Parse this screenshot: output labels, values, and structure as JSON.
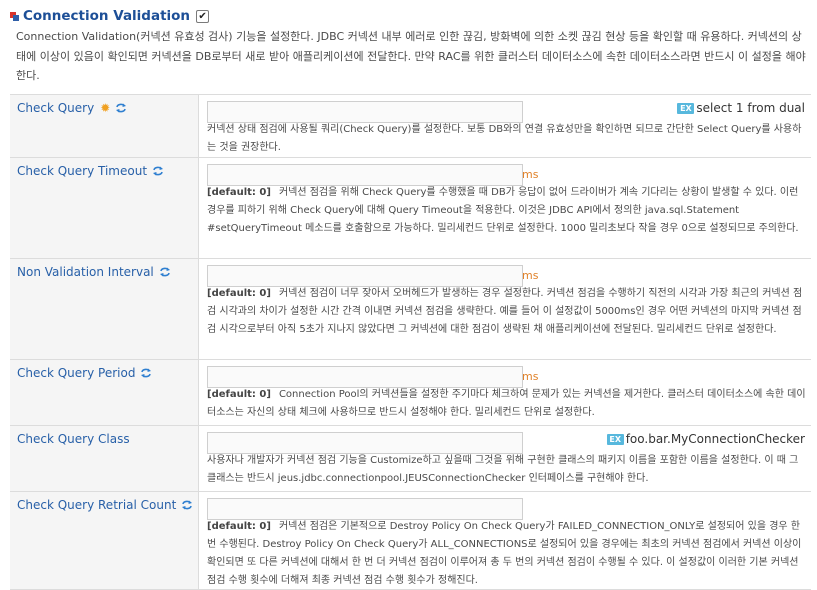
{
  "section": {
    "title": "Connection Validation",
    "enabled": true,
    "description": "Connection Validation(커넥션 유효성 검사) 기능을 설정한다. JDBC 커넥션 내부 에러로 인한 끊김, 방화벽에 의한 소켓 끊김 현상 등을 확인할 때 유용하다. 커넥션의 상태에 이상이 있음이 확인되면 커넥션을 DB로부터 새로 받아 애플리케이션에 전달한다. 만약 RAC를 위한 클러스터 데이터소스에 속한 데이터소스라면 반드시 이 설정을 해야한다."
  },
  "colors": {
    "label": "#2860a8",
    "unit": "#e0822a",
    "gear": "#f0a020",
    "example_badge": "#57b8dd"
  },
  "ex_badge": "EX",
  "fields": [
    {
      "label": "Check Query",
      "required": true,
      "value": "",
      "example": "select 1 from dual",
      "description": "커넥션 상태 점검에 사용될 쿼리(Check Query)를 설정한다. 보통 DB와의 연결 유효성만을 확인하면 되므로 간단한 Select Query를 사용하는 것을 권장한다."
    },
    {
      "label": "Check Query Timeout",
      "value": "",
      "unit": "ms",
      "default": "[default: 0]",
      "description": "커넥션 점검을 위해 Check Query를 수행했을 때 DB가 응답이 없어 드라이버가 계속 기다리는 상황이 발생할 수 있다. 이런 경우를 피하기 위해 Check Query에 대해 Query Timeout을 적용한다. 이것은 JDBC API에서 정의한 java.sql.Statement #setQueryTimeout 메소드를 호출함으로 가능하다. 밀리세컨드 단위로 설정한다. 1000 밀리초보다 작을 경우 0으로 설정되므로 주의한다."
    },
    {
      "label": "Non Validation Interval",
      "value": "",
      "unit": "ms",
      "default": "[default: 0]",
      "description": "커넥션 점검이 너무 잦아서 오버헤드가 발생하는 경우 설정한다. 커넥션 점검을 수행하기 직전의 시각과 가장 최근의 커넥션 점검 시각과의 차이가 설정한 시간 간격 이내면 커넥션 점검을 생략한다. 예를 들어 이 설정값이 5000ms인 경우 어떤 커넥션의 마지막 커넥션 점검 시각으로부터 아직 5초가 지나지 않았다면 그 커넥션에 대한 점검이 생략된 채 애플리케이션에 전달된다. 밀리세컨드 단위로 설정한다."
    },
    {
      "label": "Check Query Period",
      "value": "",
      "unit": "ms",
      "default": "[default: 0]",
      "description": "Connection Pool의 커넥션들을 설정한 주기마다 체크하여 문제가 있는 커넥션을 제거한다. 클러스터 데이터소스에 속한 데이터소스는 자신의 상태 체크에 사용하므로 반드시 설정해야 한다. 밀리세컨드 단위로 설정한다."
    },
    {
      "label": "Check Query Class",
      "value": "",
      "example": "foo.bar.MyConnectionChecker",
      "description": "사용자나 개발자가 커넥션 점검 기능을 Customize하고 싶을때 그것을 위해 구현한 클래스의 패키지 이름을 포함한 이름을 설정한다. 이 때 그 클래스는 반드시 jeus.jdbc.connectionpool.JEUSConnectionChecker 인터페이스를 구현해야 한다."
    },
    {
      "label": "Check Query Retrial Count",
      "value": "",
      "default": "[default: 0]",
      "description": "커넥션 점검은 기본적으로 Destroy Policy On Check Query가 FAILED_CONNECTION_ONLY로 설정되어 있을 경우 한 번 수행된다. Destroy Policy On Check Query가 ALL_CONNECTIONS로 설정되어 있을 경우에는 최초의 커넥션 점검에서 커넥션 이상이 확인되면 또 다른 커넥션에 대해서 한 번 더 커넥션 점검이 이루어져 총 두 번의 커넥션 점검이 수행될 수 있다. 이 설정값이 이러한 기본 커넥션 점검 수행 횟수에 더해져 최종 커넥션 점검 수행 횟수가 정해진다."
    }
  ]
}
